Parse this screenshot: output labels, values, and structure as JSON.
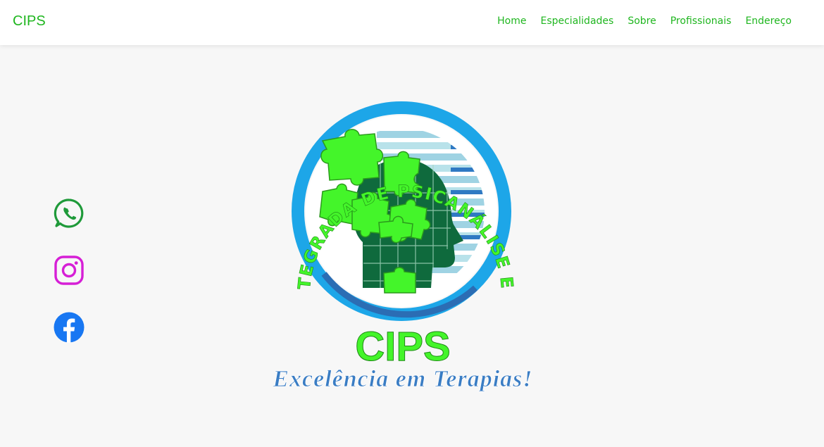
{
  "brand": "CIPS",
  "nav": {
    "items": [
      "Home",
      "Especialidades",
      "Sobre",
      "Profissionais",
      "Endereço"
    ]
  },
  "social": [
    {
      "icon": "whatsapp-icon",
      "color": "#1f9a3a"
    },
    {
      "icon": "instagram-icon",
      "color": "#d61fd6"
    },
    {
      "icon": "facebook-icon",
      "color": "#1877f2"
    }
  ],
  "logo": {
    "arc_text": "CLÍNICA INTEGRADA DE PSICANÁLISE E DA SAÚDE",
    "name": "CIPS",
    "tagline": "Excelência em Terapias!"
  },
  "colors": {
    "accent": "#1fb61f",
    "logo_green": "#44f52a",
    "logo_blue": "#1da6e8",
    "dark_green": "#0f6a3d",
    "tagline_blue": "#3a7dc4"
  }
}
